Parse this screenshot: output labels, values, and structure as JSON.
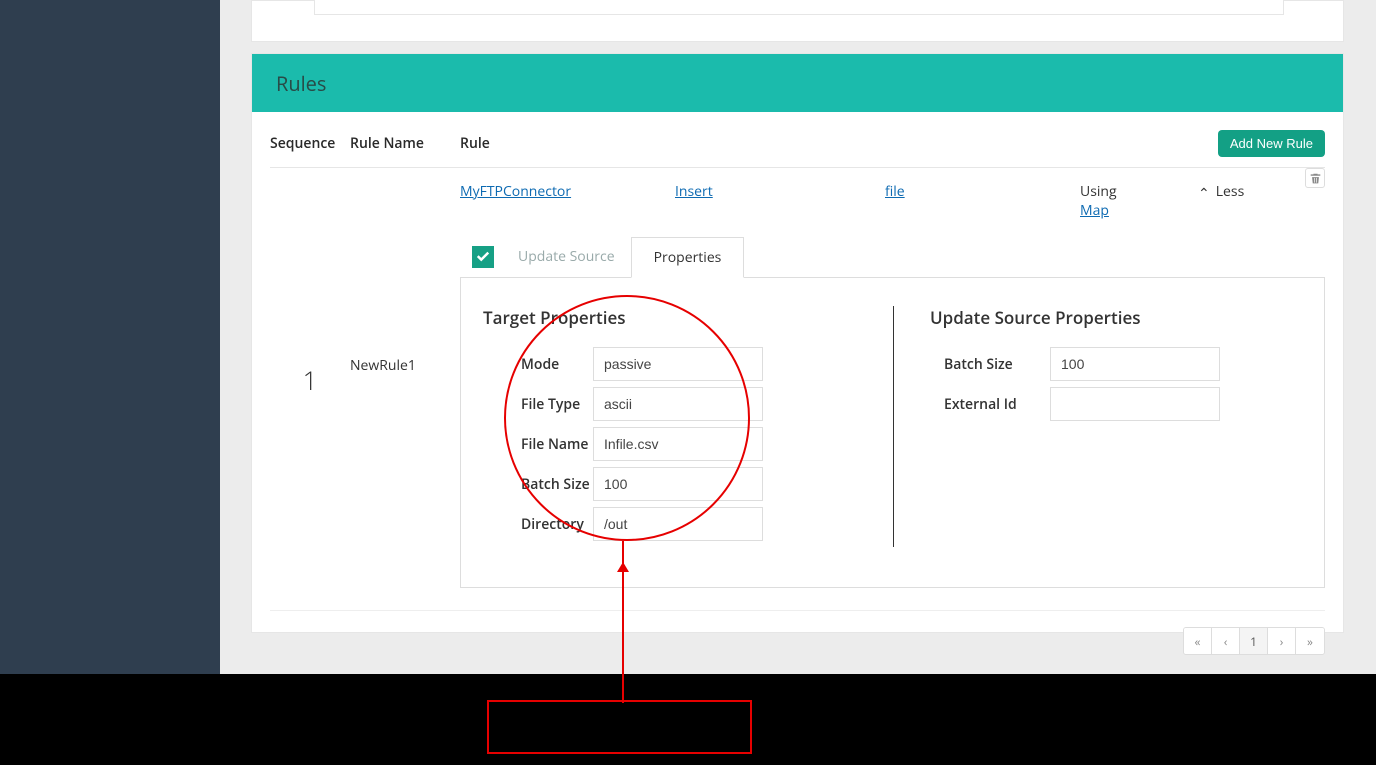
{
  "panel": {
    "title": "Rules"
  },
  "table": {
    "headers": {
      "sequence": "Sequence",
      "rule_name": "Rule Name",
      "rule": "Rule"
    },
    "add_button": "Add New Rule"
  },
  "rule": {
    "sequence": "1",
    "name": "NewRule1",
    "connector_link": "MyFTPConnector",
    "action_link": "Insert",
    "target_link": "file",
    "using_label": "Using",
    "map_link": "Map",
    "toggle_label": "Less"
  },
  "tabs": {
    "update_source": "Update Source",
    "properties": "Properties"
  },
  "target_props": {
    "title": "Target Properties",
    "mode_label": "Mode",
    "mode_value": "passive",
    "filetype_label": "File Type",
    "filetype_value": "ascii",
    "filename_label": "File Name",
    "filename_value": "Infile.csv",
    "batchsize_label": "Batch Size",
    "batchsize_value": "100",
    "directory_label": "Directory",
    "directory_value": "/out"
  },
  "source_props": {
    "title": "Update Source Properties",
    "batchsize_label": "Batch Size",
    "batchsize_value": "100",
    "externalid_label": "External Id",
    "externalid_value": ""
  },
  "pager": {
    "first": "«",
    "prev": "‹",
    "page": "1",
    "next": "›",
    "last": "»"
  }
}
